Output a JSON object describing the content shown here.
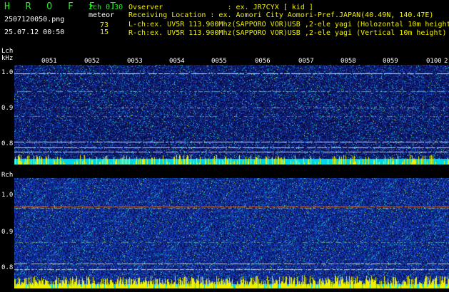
{
  "app": {
    "title_letters": "H R O F F T",
    "version": "2ch 0.30",
    "mode": "meteor",
    "filename": "2507120050.png",
    "datetime": "25.07.12 00:50",
    "lch_count": "73",
    "rch_count": "15"
  },
  "info": {
    "observer": "Ovserver               : ex. JR7CYX [ kid ]",
    "location": "Receiving Location : ex. Aomori City Aomori-Pref.JAPAN(40.49N, 140.47E)",
    "lch": "L-ch:ex. UV5R 113.900Mhz(SAPPORO VOR)USB ,2-ele yagi (Holozontal 10m height)",
    "rch": "R-ch:ex. UV5R 113.900Mhz(SAPPORO VOR)USB ,2-ele yagi (Vertical 10m height)"
  },
  "panels": {
    "left": {
      "label": "Lch",
      "unit": "kHz",
      "y_ticks": [
        "1.0",
        "0.9",
        "0.8"
      ]
    },
    "right": {
      "label": "Rch",
      "y_ticks": [
        "1.0",
        "0.9",
        "0.8"
      ]
    }
  },
  "time_ticks": [
    "0051",
    "0052",
    "0053",
    "0054",
    "0055",
    "0056",
    "0057",
    "0058",
    "0059",
    "0100",
    "2"
  ],
  "colors": {
    "background": "#000000",
    "spectrum_base": "#1a2a9a",
    "noise_floor": "#00d8e8",
    "noise_peaks": "#f0f000",
    "carrier_line": "#ffffff",
    "rch_carrier": "#e07030",
    "title": "#22ee22",
    "counts": "#f0f000"
  }
}
